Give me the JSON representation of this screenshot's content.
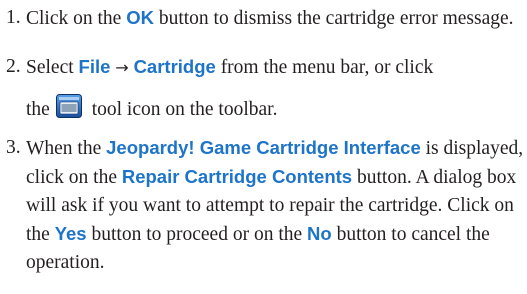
{
  "steps": [
    {
      "number": "1.",
      "text_1": "Click on the ",
      "ui_1": "OK",
      "text_2": " button to dismiss the cartridge error message."
    },
    {
      "number": "2.",
      "text_1": "Select ",
      "ui_1": "File",
      "arrow": "→",
      "ui_2": "Cartridge",
      "text_2": " from the menu bar, or click",
      "text_3": "the",
      "icon": "cartridge-tool-icon",
      "text_4": " tool icon on the toolbar."
    },
    {
      "number": "3.",
      "text_1": "When the ",
      "ui_1": "Jeopardy! Game Cartridge Interface",
      "text_2": " is displayed, click on the ",
      "ui_2": "Repair Cartridge Contents",
      "text_3": " button. A dialog box will ask if you want to attempt to repair the cartridge. Click on the ",
      "ui_3": "Yes",
      "text_4": " button to proceed or on the ",
      "ui_4": "No",
      "text_5": " button to cancel the operation."
    }
  ],
  "colors": {
    "ui_text": "#1e74c9",
    "body_text": "#231f20"
  }
}
